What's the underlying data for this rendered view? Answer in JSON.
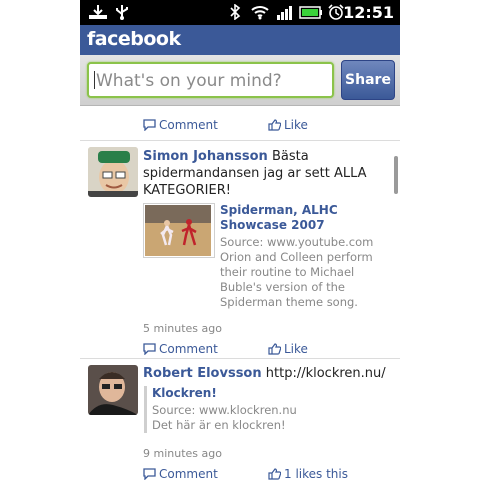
{
  "status_bar": {
    "time": "12:51"
  },
  "header": {
    "logo": "facebook"
  },
  "composer": {
    "placeholder": "What's on your mind?",
    "share_label": "Share"
  },
  "feed": {
    "top_actions": {
      "comment": "Comment",
      "like": "Like"
    },
    "posts": [
      {
        "author": "Simon Johansson",
        "message": "Bästa spidermandansen jag ar sett ALLA KATEGORIER!",
        "attachment": {
          "title": "Spiderman, ALHC Showcase 2007",
          "source": "Source: www.youtube.com",
          "description": "Orion and Colleen perform their routine to Michael Buble's version of the Spiderman theme song."
        },
        "time": "5 minutes ago",
        "comment_label": "Comment",
        "like_label": "Like"
      },
      {
        "author": "Robert Elovsson",
        "message": "http://klockren.nu/",
        "attachment": {
          "title": "Klockren!",
          "source": "Source: www.klockren.nu",
          "description": "Det här är en klockren!"
        },
        "time": "9 minutes ago",
        "comment_label": "Comment",
        "like_label": "1 likes this"
      }
    ]
  }
}
